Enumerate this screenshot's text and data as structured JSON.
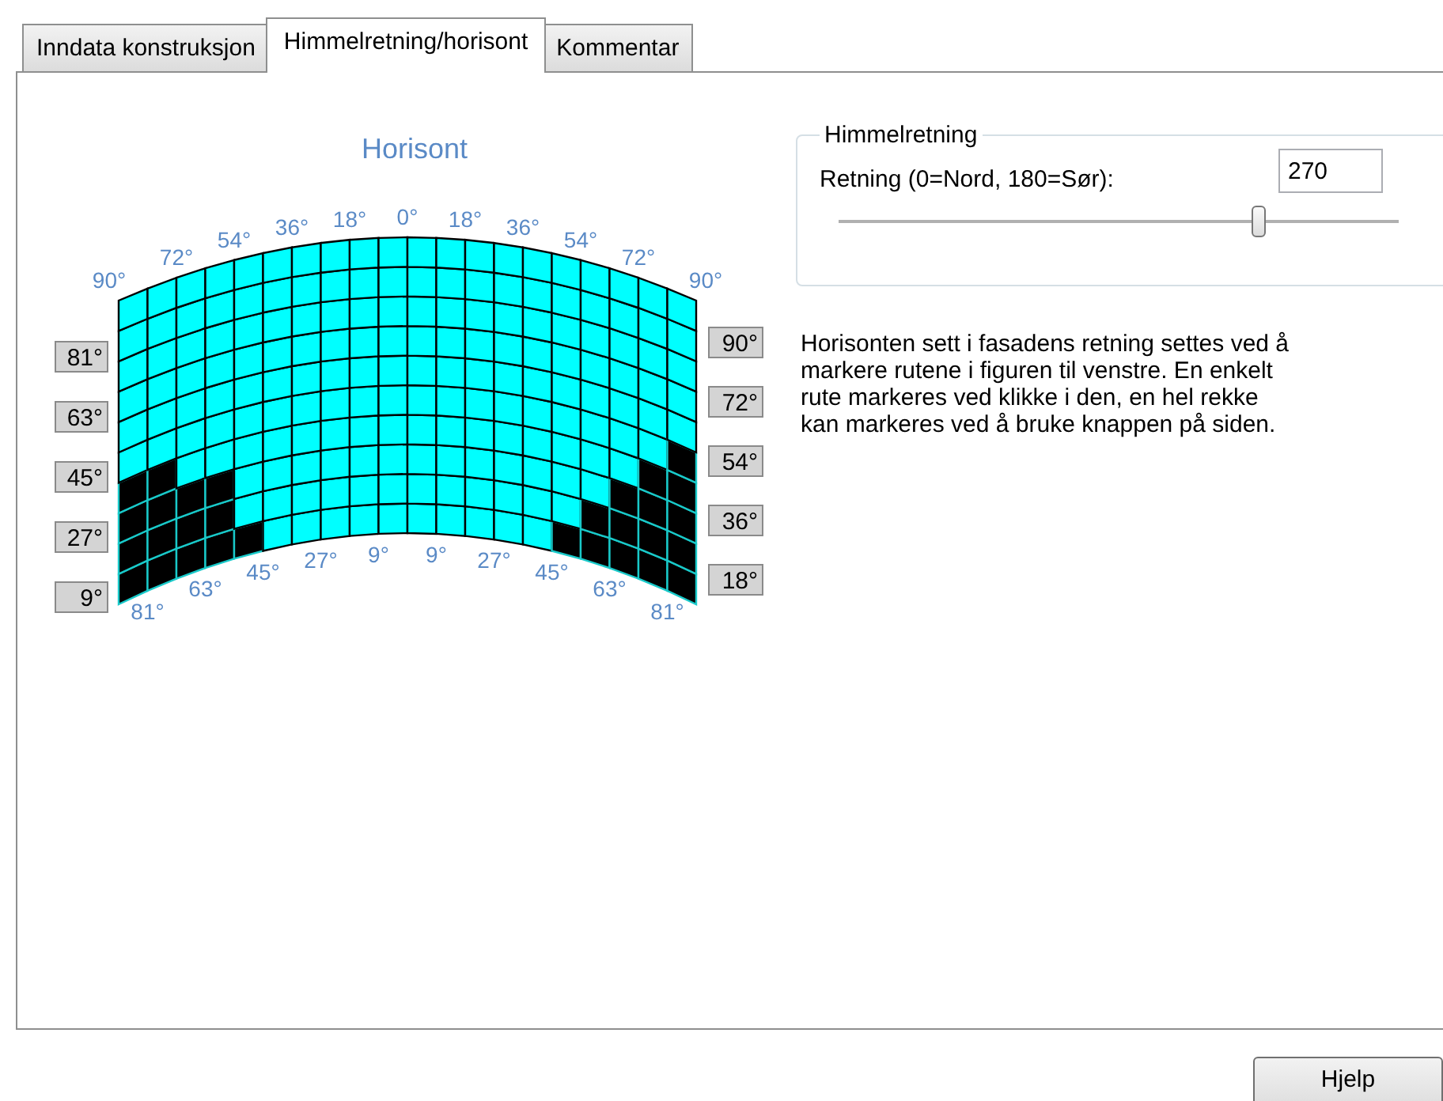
{
  "tabs": [
    {
      "label": "Inndata konstruksjon",
      "selected": false
    },
    {
      "label": "Himmelretning/horisont",
      "selected": true
    },
    {
      "label": "Kommentar",
      "selected": false
    }
  ],
  "horizon": {
    "title": "Horisont",
    "top_labels": [
      "90°",
      "72°",
      "54°",
      "36°",
      "18°",
      "0°",
      "18°",
      "36°",
      "54°",
      "72°",
      "90°"
    ],
    "bottom_labels": [
      "81°",
      "63°",
      "45°",
      "27°",
      "9°",
      "9°",
      "27°",
      "45°",
      "63°",
      "81°"
    ],
    "left_buttons": [
      "81°",
      "63°",
      "45°",
      "27°",
      "9°"
    ],
    "right_buttons": [
      "90°",
      "72°",
      "54°",
      "36°",
      "18°"
    ],
    "columns": [
      {
        "marked": [
          true,
          true,
          true,
          true,
          false,
          false,
          false,
          false,
          false,
          false
        ]
      },
      {
        "marked": [
          true,
          true,
          true,
          true,
          false,
          false,
          false,
          false,
          false,
          false
        ]
      },
      {
        "marked": [
          true,
          true,
          true,
          false,
          false,
          false,
          false,
          false,
          false,
          false
        ]
      },
      {
        "marked": [
          true,
          true,
          true,
          false,
          false,
          false,
          false,
          false,
          false,
          false
        ]
      },
      {
        "marked": [
          true,
          false,
          false,
          false,
          false,
          false,
          false,
          false,
          false,
          false
        ]
      },
      {
        "marked": [
          false,
          false,
          false,
          false,
          false,
          false,
          false,
          false,
          false,
          false
        ]
      },
      {
        "marked": [
          false,
          false,
          false,
          false,
          false,
          false,
          false,
          false,
          false,
          false
        ]
      },
      {
        "marked": [
          false,
          false,
          false,
          false,
          false,
          false,
          false,
          false,
          false,
          false
        ]
      },
      {
        "marked": [
          false,
          false,
          false,
          false,
          false,
          false,
          false,
          false,
          false,
          false
        ]
      },
      {
        "marked": [
          false,
          false,
          false,
          false,
          false,
          false,
          false,
          false,
          false,
          false
        ]
      },
      {
        "marked": [
          false,
          false,
          false,
          false,
          false,
          false,
          false,
          false,
          false,
          false
        ]
      },
      {
        "marked": [
          false,
          false,
          false,
          false,
          false,
          false,
          false,
          false,
          false,
          false
        ]
      },
      {
        "marked": [
          false,
          false,
          false,
          false,
          false,
          false,
          false,
          false,
          false,
          false
        ]
      },
      {
        "marked": [
          false,
          false,
          false,
          false,
          false,
          false,
          false,
          false,
          false,
          false
        ]
      },
      {
        "marked": [
          false,
          false,
          false,
          false,
          false,
          false,
          false,
          false,
          false,
          false
        ]
      },
      {
        "marked": [
          true,
          false,
          false,
          false,
          false,
          false,
          false,
          false,
          false,
          false
        ]
      },
      {
        "marked": [
          true,
          true,
          false,
          false,
          false,
          false,
          false,
          false,
          false,
          false
        ]
      },
      {
        "marked": [
          true,
          true,
          true,
          false,
          false,
          false,
          false,
          false,
          false,
          false
        ]
      },
      {
        "marked": [
          true,
          true,
          true,
          true,
          false,
          false,
          false,
          false,
          false,
          false
        ]
      },
      {
        "marked": [
          true,
          true,
          true,
          true,
          true,
          false,
          false,
          false,
          false,
          false
        ]
      }
    ]
  },
  "direction": {
    "group_title": "Himmelretning",
    "label": "Retning (0=Nord, 180=Sør):",
    "value": "270",
    "level": 0.75
  },
  "description": [
    "Horisonten sett i fasadens retning settes ved å",
    "markere rutene i figuren til venstre. En enkelt",
    "rute markeres ved klikke i den, en hel rekke",
    "kan markeres ved å bruke knappen på siden."
  ],
  "help_button": "Hjelp"
}
